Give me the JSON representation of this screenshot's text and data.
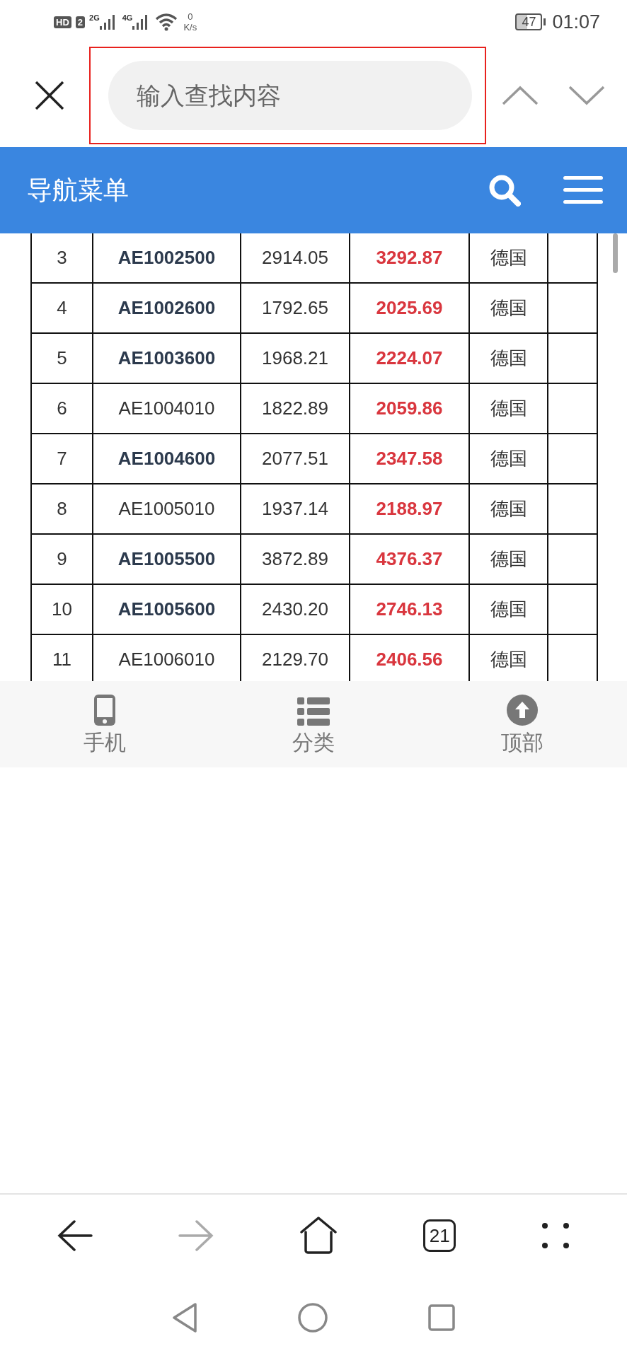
{
  "status_bar": {
    "hd": "HD",
    "sim": "2",
    "net1": "2G",
    "net2": "4G",
    "speed": "0",
    "speed_unit": "K/s",
    "battery": "47",
    "time": "01:07"
  },
  "find_bar": {
    "placeholder": "输入查找内容"
  },
  "header": {
    "title": "导航菜单"
  },
  "table": {
    "rows": [
      {
        "index": "3",
        "code": "AE1002500",
        "bold": true,
        "price": "2914.05",
        "sale": "3292.87",
        "country": "德国"
      },
      {
        "index": "4",
        "code": "AE1002600",
        "bold": true,
        "price": "1792.65",
        "sale": "2025.69",
        "country": "德国"
      },
      {
        "index": "5",
        "code": "AE1003600",
        "bold": true,
        "price": "1968.21",
        "sale": "2224.07",
        "country": "德国"
      },
      {
        "index": "6",
        "code": "AE1004010",
        "bold": false,
        "price": "1822.89",
        "sale": "2059.86",
        "country": "德国"
      },
      {
        "index": "7",
        "code": "AE1004600",
        "bold": true,
        "price": "2077.51",
        "sale": "2347.58",
        "country": "德国"
      },
      {
        "index": "8",
        "code": "AE1005010",
        "bold": false,
        "price": "1937.14",
        "sale": "2188.97",
        "country": "德国"
      },
      {
        "index": "9",
        "code": "AE1005500",
        "bold": true,
        "price": "3872.89",
        "sale": "4376.37",
        "country": "德国"
      },
      {
        "index": "10",
        "code": "AE1005600",
        "bold": true,
        "price": "2430.20",
        "sale": "2746.13",
        "country": "德国"
      },
      {
        "index": "11",
        "code": "AE1006010",
        "bold": false,
        "price": "2129.70",
        "sale": "2406.56",
        "country": "德国"
      }
    ]
  },
  "bottom_tabs": [
    {
      "kind": "phone",
      "label": "手机"
    },
    {
      "kind": "list",
      "label": "分类"
    },
    {
      "kind": "top",
      "label": "顶部"
    }
  ],
  "browser_bar": {
    "forward_disabled": true,
    "tab_count": "21"
  }
}
